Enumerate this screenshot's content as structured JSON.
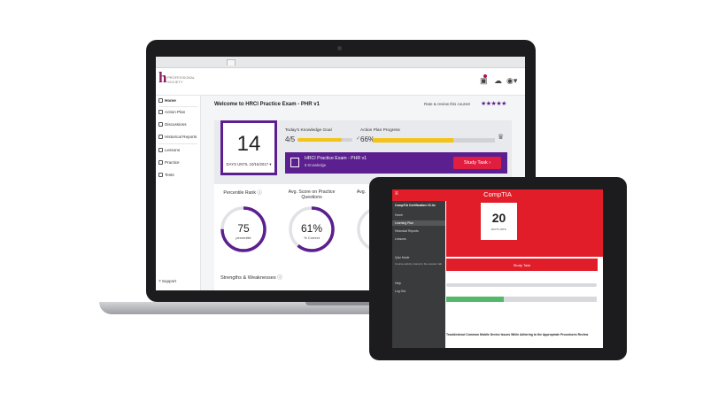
{
  "app": {
    "logo_text": "PROFESSIONAL SOCIETY",
    "title": "Welcome to HRCI Practice Exam - PHR v1",
    "rate_text": "Rate & review this course!",
    "stars": "★★★★★"
  },
  "sidebar": {
    "items": [
      {
        "label": "Home"
      },
      {
        "label": "Action Plan"
      },
      {
        "label": "Discussions"
      },
      {
        "label": "Historical Reports"
      },
      {
        "label": "Lessons"
      },
      {
        "label": "Practice"
      },
      {
        "label": "Tests"
      }
    ],
    "support": "Support"
  },
  "summary": {
    "days": "14",
    "days_label": "DAYS UNTIL 10/15/2017",
    "knowledge_goal_label": "Today's Knowledge Goal",
    "knowledge_goal_value": "4/5",
    "knowledge_goal_progress": 0.8,
    "action_plan_label": "Action Plan Progress",
    "action_plan_value": "66%",
    "action_plan_progress": 0.66,
    "banner_title": "HRCI Practice Exam - PHR v1",
    "banner_sub": "8 Knowledge",
    "study_button": "Study Task"
  },
  "stats": {
    "percentile_label": "Percentile Rank",
    "percentile_value": "75",
    "percentile_unit": "percentile",
    "percentile_fraction": 0.75,
    "avg_score_label": "Avg. Score on Practice Questions",
    "avg_score_value": "61%",
    "avg_score_unit": "% Correct",
    "avg_score_fraction": 0.61,
    "third_label": "Avg.",
    "strengths_label": "Strengths & Weaknesses"
  },
  "tablet": {
    "brand": "CompTIA",
    "course": "CompTIA Certification V2.4n",
    "nav": [
      "Home",
      "Learning Plan",
      "Historical Reports",
      "Lessons",
      "Quiz Mode",
      "Help",
      "Log Out"
    ],
    "sub_text": "Course activity stored in the session tab",
    "days": "20",
    "days_label": "DAYS UNTIL",
    "study_button": "Study Task",
    "bottom_text": "Troubleshoot Common Mobile Device Issues While Adhering to the Appropriate Procedures Review"
  },
  "colors": {
    "purple": "#5c1f8f",
    "red": "#e11d2a",
    "yellow": "#f2c318",
    "green": "#52b86a"
  }
}
